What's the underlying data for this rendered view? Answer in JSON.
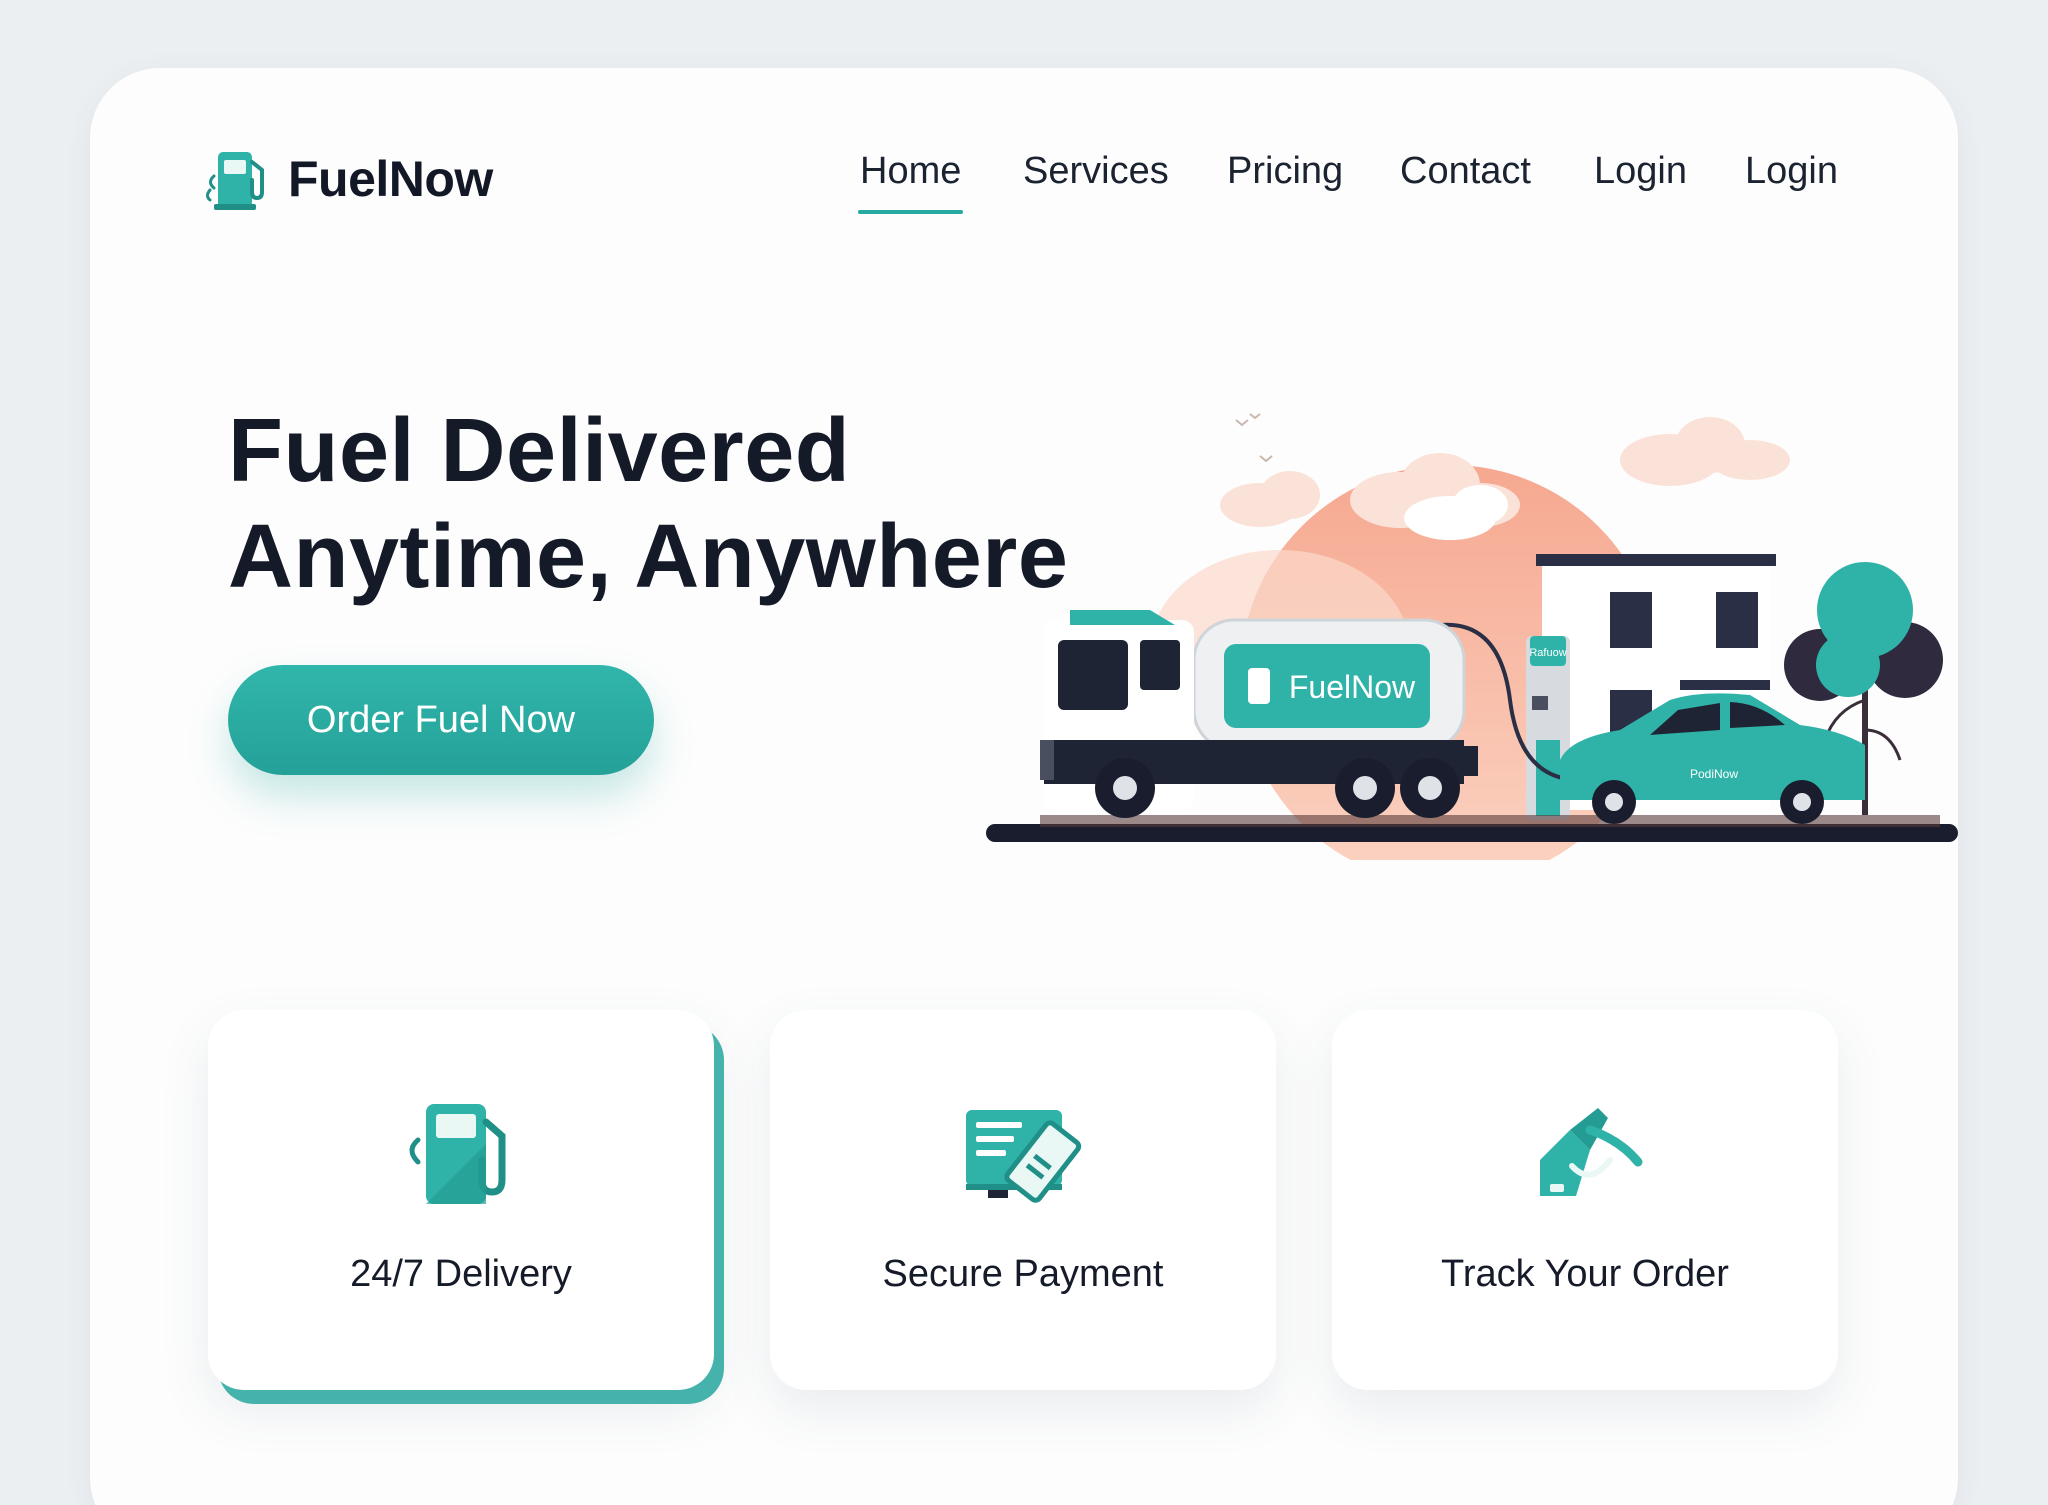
{
  "brand": {
    "name": "FuelNow",
    "accent": "#25a9a0",
    "dark": "#141a28",
    "sun": "#f7a88c"
  },
  "nav": {
    "items": [
      {
        "label": "Home",
        "active": true
      },
      {
        "label": "Services"
      },
      {
        "label": "Pricing"
      },
      {
        "label": "Contact"
      },
      {
        "label": "Login"
      },
      {
        "label": "Login"
      }
    ]
  },
  "hero": {
    "title_line1": "Fuel Delivered",
    "title_line2": "Anytime, Anywhere",
    "cta_label": "Order Fuel Now",
    "illustration": {
      "tank_label": "FuelNow",
      "pump_label": "Rafuow",
      "car_label": "PodiNow",
      "icons": [
        "truck",
        "fuel-pump",
        "car",
        "house",
        "tree",
        "sun",
        "clouds",
        "birds"
      ]
    }
  },
  "features": [
    {
      "label": "24/7 Delivery",
      "icon": "fuel-pump-icon",
      "highlighted": true
    },
    {
      "label": "Secure Payment",
      "icon": "payment-card-icon"
    },
    {
      "label": "Track Your Order",
      "icon": "fuel-nozzle-icon"
    }
  ]
}
